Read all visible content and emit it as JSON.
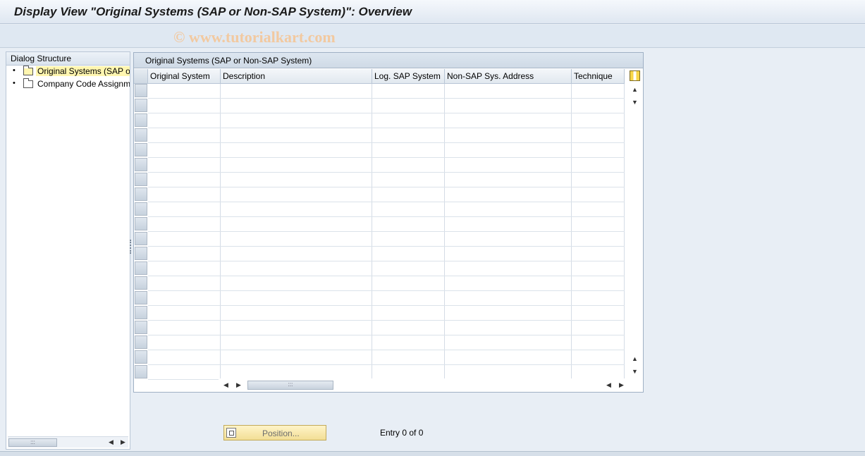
{
  "window": {
    "title": "Display View \"Original Systems (SAP or Non-SAP System)\": Overview",
    "watermark": "© www.tutorialkart.com"
  },
  "dialog_structure": {
    "header": "Dialog Structure",
    "items": [
      {
        "label": "Original Systems (SAP or Non-SAP System)",
        "selected": true,
        "icon": "open-folder-icon"
      },
      {
        "label": "Company Code Assignment",
        "selected": false,
        "icon": "folder-icon"
      }
    ]
  },
  "table": {
    "caption": "Original Systems (SAP or Non-SAP System)",
    "columns": [
      "Original System",
      "Description",
      "Log. SAP System",
      "Non-SAP Sys. Address",
      "Technique"
    ],
    "rows": []
  },
  "footer": {
    "position_button": "Position...",
    "entry_text": "Entry 0 of 0"
  },
  "colors": {
    "selected_highlight": "#fff6b0",
    "button_yellow": "#f2de95"
  }
}
